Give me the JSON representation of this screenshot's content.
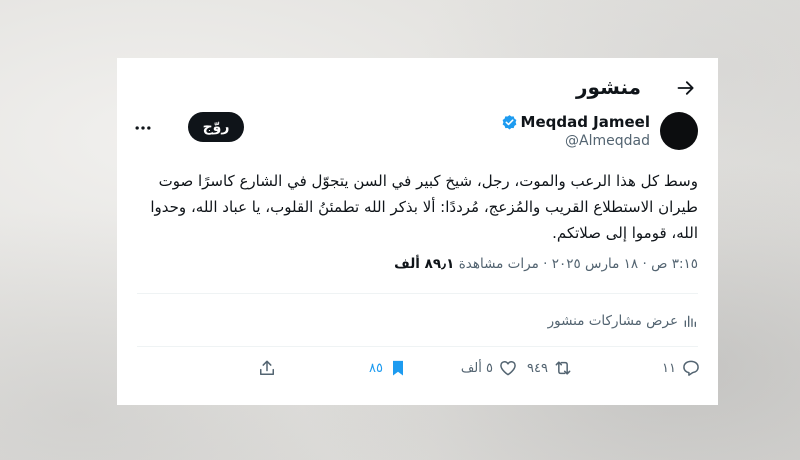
{
  "header": {
    "title": "منشور"
  },
  "user": {
    "display_name": "Meqdad Jameel",
    "handle": "@Almeqdad"
  },
  "follow_button": "روّج",
  "tweet": {
    "text": "وسط كل هذا الرعب والموت، رجل، شيخ كبير في السن يتجوّل في الشارع كاسرًا صوت طيران الاستطلاع القريب والمُزعج، مُرددًا: ألا بذكر الله تطمئنُ القلوب، يا عباد الله، وحدوا الله، قوموا إلى صلاتكم."
  },
  "meta": {
    "time": "٣:١٥ ص",
    "separator": "·",
    "date": "١٨ مارس ٢٠٢٥",
    "views_count": "٨٩٫١ ألف",
    "views_label": "مرات مشاهدة"
  },
  "quotes": {
    "label": "عرض مشاركات منشور"
  },
  "actions": {
    "replies": "١١",
    "reposts": "٩٤٩",
    "likes": "٥ ألف",
    "bookmarks": "٨٥"
  },
  "colors": {
    "accent": "#1d9bf0",
    "text": "#0f1419",
    "secondary": "#536471",
    "verified": "#1d9bf0"
  },
  "icons": [
    "back-arrow-icon",
    "verified-badge-icon",
    "more-icon",
    "view-stats-icon",
    "reply-icon",
    "repost-icon",
    "like-icon",
    "bookmark-icon",
    "share-icon"
  ]
}
